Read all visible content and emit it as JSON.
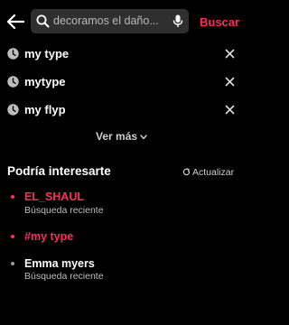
{
  "search": {
    "query": "decoramos el daño...",
    "submit_label": "Buscar"
  },
  "history": [
    {
      "label": "my type"
    },
    {
      "label": "mytype"
    },
    {
      "label": "my flyp"
    }
  ],
  "see_more_label": "Ver más",
  "suggestions_section": {
    "title": "Podría interesarte",
    "refresh_label": "Actualizar",
    "items": [
      {
        "title": "EL_SHAUL",
        "subtitle": "Búsqueda reciente",
        "highlight": true
      },
      {
        "title": "#my type",
        "subtitle": "",
        "highlight": true
      },
      {
        "title": "Emma myers",
        "subtitle": "Búsqueda reciente",
        "highlight": false
      }
    ]
  },
  "colors": {
    "background": "#000000",
    "accent": "#fe2c55",
    "search_field": "#2f2f2f",
    "muted_text": "#bdbdbd"
  },
  "icons": {
    "back": "arrow-left-icon",
    "search": "magnifier-icon",
    "mic": "microphone-icon",
    "history": "clock-icon",
    "remove": "close-icon",
    "expand": "chevron-down-icon",
    "refresh": "refresh-icon"
  }
}
